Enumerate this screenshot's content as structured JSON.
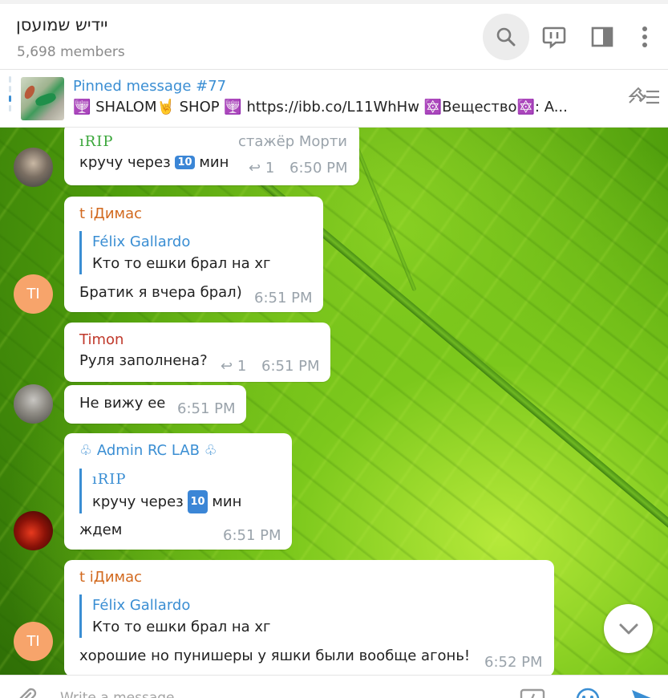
{
  "header": {
    "title": "יידיש שמועסן",
    "subtitle": "5,698 members",
    "icons": [
      "search-icon",
      "discussion-icon",
      "sidebar-icon",
      "more-icon"
    ]
  },
  "pinned": {
    "title": "Pinned message #77",
    "text": "🕎 SHALOM🤘 SHOP 🕎  https://ibb.co/L11WhHw 🔯Вещество🔯: A..."
  },
  "messages": [
    {
      "sender": "",
      "reply_to": "ıRIP",
      "reply_name": "стажёр Морти",
      "text": "кручу через",
      "text_end": "мин",
      "replies": "1",
      "time": "6:50 PM"
    },
    {
      "sender": "t iДимас",
      "quote_name": "Félix Gallardo",
      "quote_text": "Кто то ешки брал на хг",
      "text": "Братик я вчера брал)",
      "time": "6:51 PM",
      "avatar": "TI"
    },
    {
      "sender": "Timon",
      "text": "Руля заполнена?",
      "replies": "1",
      "time": "6:51 PM"
    },
    {
      "text": "Не вижу ее",
      "time": "6:51 PM"
    },
    {
      "sender": "♧ Admin RC LAB ♧",
      "quote_name": "ıRIP",
      "quote_text": "кручу через",
      "quote_text_end": "мин",
      "text": "ждем",
      "time": "6:51 PM"
    },
    {
      "sender": "t iДимас",
      "quote_name": "Félix Gallardo",
      "quote_text": "Кто то ешки брал на хг",
      "text": "хорошие но пунишеры  у яшки были вообще агонь!",
      "time": "6:52 PM",
      "avatar": "TI"
    }
  ],
  "emoji_ten": "10",
  "composer": {
    "placeholder": "Write a message..."
  },
  "colors": {
    "accent": "#3a8ed3",
    "timon": "#c0392b",
    "dimas": "#d2691e",
    "admin": "#3a8ed3",
    "avatar_ti": "#f7a46b"
  }
}
